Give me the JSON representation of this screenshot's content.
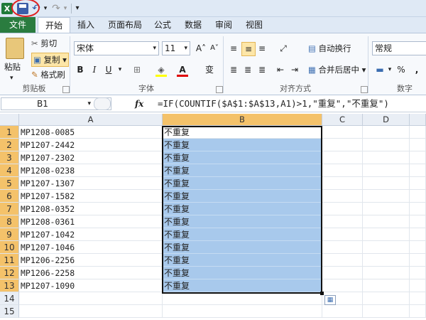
{
  "qat": {
    "app_icon_letter": "X",
    "undo": "↶",
    "redo": "↷",
    "customize": "▾"
  },
  "tabs": [
    "文件",
    "开始",
    "插入",
    "页面布局",
    "公式",
    "数据",
    "审阅",
    "视图"
  ],
  "ribbon": {
    "clipboard": {
      "paste": "粘贴",
      "cut": "剪切",
      "copy": "复制",
      "format_painter": "格式刷",
      "group": "剪贴板"
    },
    "font": {
      "name": "宋体",
      "size": "11",
      "grow": "A˄",
      "shrink": "A˅",
      "bold": "B",
      "italic": "I",
      "underline": "U",
      "wen": "变",
      "group": "字体"
    },
    "alignment": {
      "wrap": "自动换行",
      "merge": "合并后居中",
      "group": "对齐方式"
    },
    "number": {
      "format": "常规",
      "percent": "%",
      "comma": ",",
      "group": "数字"
    }
  },
  "formula_bar": {
    "name_box": "B1",
    "fx": "fx",
    "formula": "=IF(COUNTIF($A$1:$A$13,A1)>1,\"重复\",\"不重复\")"
  },
  "grid": {
    "columns": [
      "A",
      "B",
      "C",
      "D"
    ],
    "rows": [
      {
        "num": "1",
        "a": "MP1208-0085",
        "b": "不重复"
      },
      {
        "num": "2",
        "a": "MP1207-2442",
        "b": "不重复"
      },
      {
        "num": "3",
        "a": "MP1207-2302",
        "b": "不重复"
      },
      {
        "num": "4",
        "a": "MP1208-0238",
        "b": "不重复"
      },
      {
        "num": "5",
        "a": "MP1207-1307",
        "b": "不重复"
      },
      {
        "num": "6",
        "a": "MP1207-1582",
        "b": "不重复"
      },
      {
        "num": "7",
        "a": "MP1208-0352",
        "b": "不重复"
      },
      {
        "num": "8",
        "a": "MP1208-0361",
        "b": "不重复"
      },
      {
        "num": "9",
        "a": "MP1207-1042",
        "b": "不重复"
      },
      {
        "num": "10",
        "a": "MP1207-1046",
        "b": "不重复"
      },
      {
        "num": "11",
        "a": "MP1206-2256",
        "b": "不重复"
      },
      {
        "num": "12",
        "a": "MP1206-2258",
        "b": "不重复"
      },
      {
        "num": "13",
        "a": "MP1207-1090",
        "b": "不重复"
      },
      {
        "num": "14",
        "a": "",
        "b": ""
      },
      {
        "num": "15",
        "a": "",
        "b": ""
      }
    ]
  },
  "colors": {
    "selection": "#a8c9ec",
    "file_tab": "#2a7c3f",
    "highlight_circle": "#e02020",
    "row_header_selected": "#f4c26a"
  }
}
